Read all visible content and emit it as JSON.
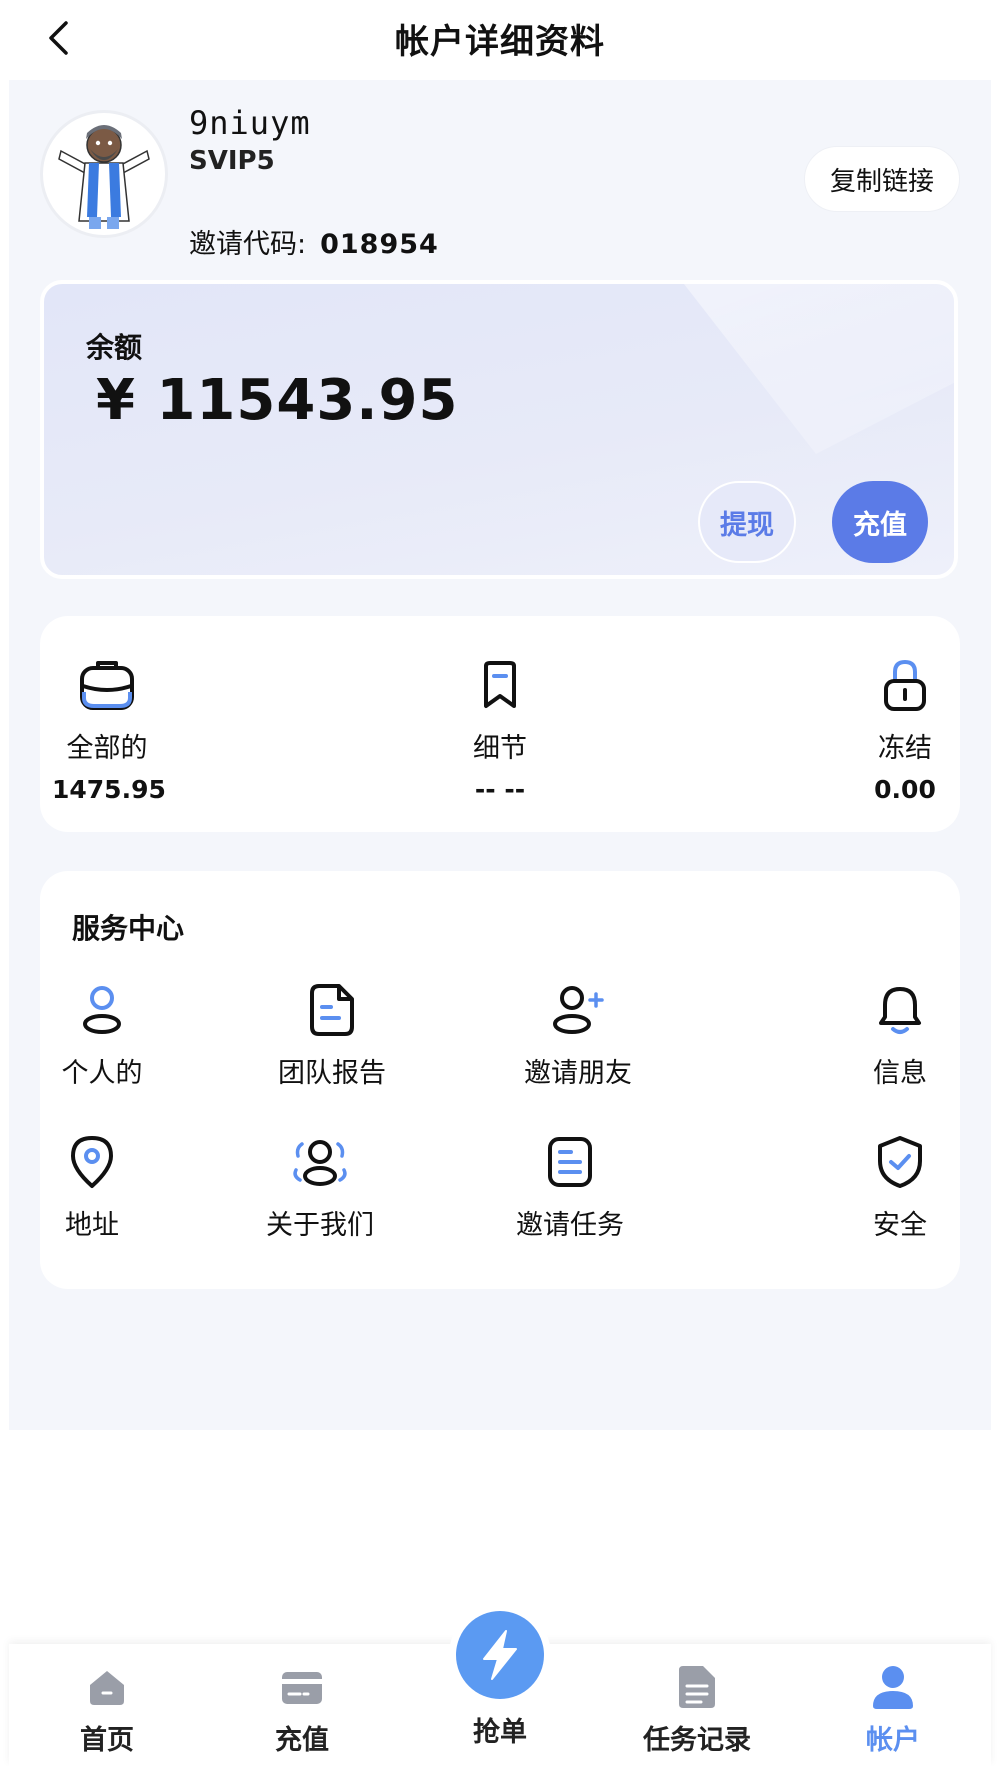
{
  "header": {
    "title": "帐户详细资料"
  },
  "profile": {
    "username": "9niuym",
    "level": "SVIP5",
    "invite_label": "邀请代码:",
    "invite_code": "018954",
    "copy_link_label": "复制链接"
  },
  "balance": {
    "label": "余额",
    "amount": "¥ 11543.95",
    "withdraw_label": "提现",
    "recharge_label": "充值"
  },
  "stats": [
    {
      "label": "全部的",
      "value": "1475.95",
      "icon": "briefcase-icon"
    },
    {
      "label": "细节",
      "value": "-- --",
      "icon": "bookmark-icon"
    },
    {
      "label": "冻结",
      "value": "0.00",
      "icon": "lock-icon"
    }
  ],
  "service": {
    "title": "服务中心",
    "items": [
      {
        "label": "个人的",
        "icon": "person-icon"
      },
      {
        "label": "团队报告",
        "icon": "document-icon"
      },
      {
        "label": "邀请朋友",
        "icon": "add-user-icon"
      },
      {
        "label": "信息",
        "icon": "bell-icon"
      },
      {
        "label": "地址",
        "icon": "location-pin-icon"
      },
      {
        "label": "关于我们",
        "icon": "group-icon"
      },
      {
        "label": "邀请任务",
        "icon": "task-list-icon"
      },
      {
        "label": "安全",
        "icon": "shield-check-icon"
      }
    ]
  },
  "nav": {
    "home": "首页",
    "recharge": "充值",
    "grab": "抢单",
    "tasks": "任务记录",
    "account": "帐户"
  },
  "colors": {
    "accent": "#5b7be7",
    "nav_active": "#5b8ff0",
    "background": "#f4f6fb"
  }
}
